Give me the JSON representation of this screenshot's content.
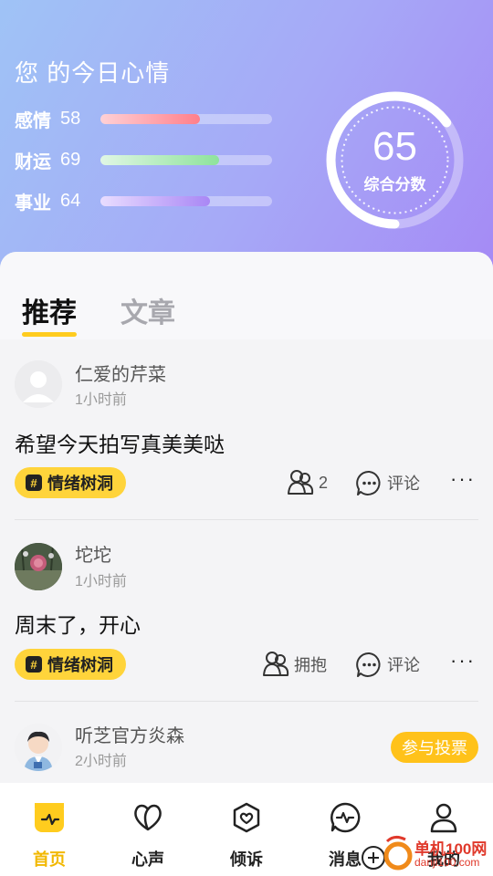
{
  "header": {
    "title": "您 的今日心情",
    "metrics": [
      {
        "name": "感情",
        "value": "58",
        "level": 0.58,
        "color_from": "#ffd1d6",
        "color_to": "#ff7f8a"
      },
      {
        "name": "财运",
        "value": "69",
        "level": 0.69,
        "color_from": "#e0f6e4",
        "color_to": "#8ee39c"
      },
      {
        "name": "事业",
        "value": "64",
        "level": 0.64,
        "color_from": "#e9ddff",
        "color_to": "#a987f5"
      }
    ],
    "score": {
      "value": "65",
      "label": "综合分数",
      "level": 0.65
    }
  },
  "tabs": [
    {
      "label": "推荐",
      "active": true
    },
    {
      "label": "文章",
      "active": false
    }
  ],
  "posts": [
    {
      "name": "仁爱的芹菜",
      "time": "1小时前",
      "text": "希望今天拍写真美美哒",
      "tag": "情绪树洞",
      "hug_label": "2",
      "comment_label": "评论",
      "avatar": "default-avatar"
    },
    {
      "name": "坨坨",
      "time": "1小时前",
      "text": "周末了，开心",
      "tag": "情绪树洞",
      "hug_label": "拥抱",
      "comment_label": "评论",
      "avatar": "flower-photo"
    },
    {
      "name": "听芝官方炎森",
      "time": "2小时前",
      "vote_label": "参与投票",
      "avatar": "official-cartoon"
    }
  ],
  "nav": [
    {
      "label": "首页",
      "icon": "home-icon",
      "active": true
    },
    {
      "label": "心声",
      "icon": "heart-icon",
      "active": false
    },
    {
      "label": "倾诉",
      "icon": "heart-shield-icon",
      "active": false
    },
    {
      "label": "消息",
      "icon": "pulse-icon",
      "active": false
    },
    {
      "label": "我的",
      "icon": "user-icon",
      "active": false
    }
  ],
  "watermark": {
    "text": "单机100网",
    "sub": "danji100.com"
  },
  "colors": {
    "accent": "#ffcc1e",
    "tag_bg": "#ffd43b",
    "vote_bg": "#ffc21a"
  }
}
